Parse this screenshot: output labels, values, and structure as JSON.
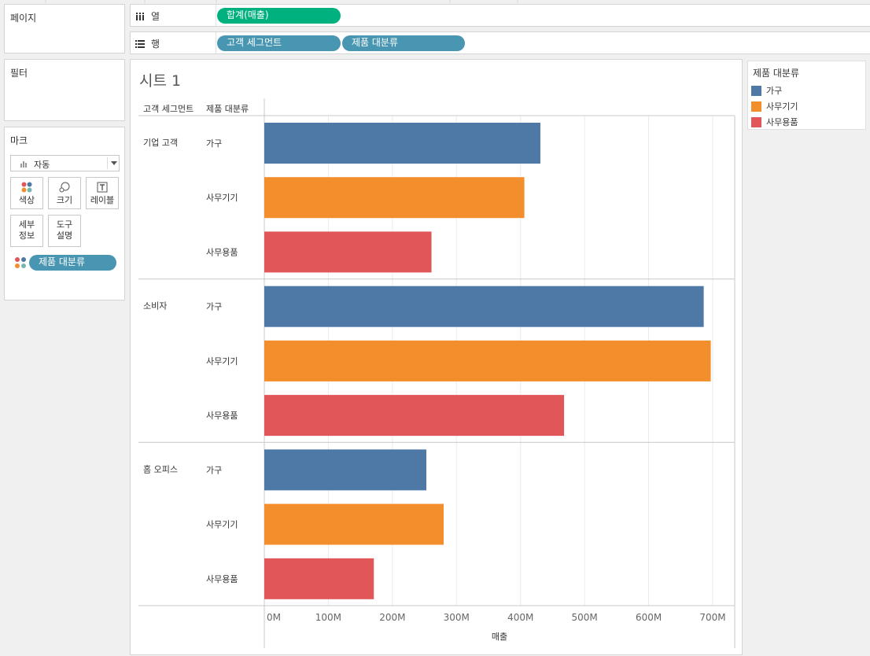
{
  "pages_panel": {
    "title": "페이지"
  },
  "columns_shelf": {
    "label": "열",
    "pills": [
      "합계(매출)"
    ]
  },
  "rows_shelf": {
    "label": "행",
    "pills": [
      "고객 세그먼트",
      "제품 대분류"
    ]
  },
  "filters_panel": {
    "title": "필터"
  },
  "marks_panel": {
    "title": "마크",
    "mark_type": "자동",
    "buttons": {
      "color": "색상",
      "size": "크기",
      "label": "레이블",
      "detail_1": "세부",
      "detail_2": "정보",
      "tooltip_1": "도구",
      "tooltip_2": "설명"
    },
    "color_pill": "제품 대분류"
  },
  "legend": {
    "title": "제품 대분류",
    "items": [
      {
        "name": "가구",
        "color": "#4e79a7"
      },
      {
        "name": "사무기기",
        "color": "#f28e2b"
      },
      {
        "name": "사무용품",
        "color": "#e15759"
      }
    ]
  },
  "sheet": {
    "title": "시트 1"
  },
  "chart_data": {
    "type": "bar",
    "orientation": "horizontal",
    "row_headers": [
      "고객 세그먼트",
      "제품 대분류"
    ],
    "groups": [
      {
        "name": "기업 고객",
        "bars": [
          {
            "category": "가구",
            "value": 431
          },
          {
            "category": "사무기기",
            "value": 406
          },
          {
            "category": "사무용품",
            "value": 261
          }
        ]
      },
      {
        "name": "소비자",
        "bars": [
          {
            "category": "가구",
            "value": 686
          },
          {
            "category": "사무기기",
            "value": 697
          },
          {
            "category": "사무용품",
            "value": 468
          }
        ]
      },
      {
        "name": "홈 오피스",
        "bars": [
          {
            "category": "가구",
            "value": 253
          },
          {
            "category": "사무기기",
            "value": 280
          },
          {
            "category": "사무용품",
            "value": 171
          }
        ]
      }
    ],
    "value_unit": "M",
    "xlabel": "매출",
    "xlim": [
      0,
      730
    ],
    "xticks": [
      0,
      100,
      200,
      300,
      400,
      500,
      600,
      700
    ],
    "xtick_labels": [
      "0M",
      "100M",
      "200M",
      "300M",
      "400M",
      "500M",
      "600M",
      "700M"
    ],
    "colors": {
      "가구": "#4e79a7",
      "사무기기": "#f28e2b",
      "사무용품": "#e15759"
    },
    "grid": "vertical",
    "legend_position": "right"
  }
}
